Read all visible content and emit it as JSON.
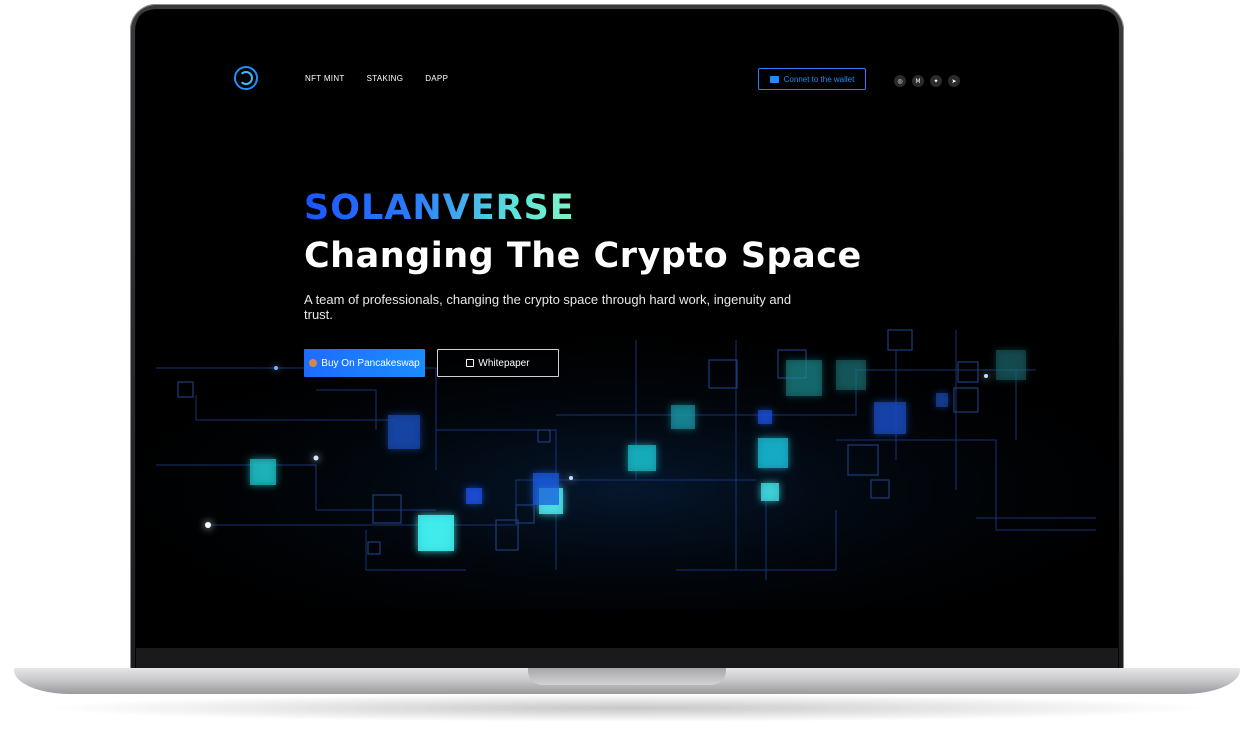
{
  "nav": {
    "items": [
      "NFT MINT",
      "STAKING",
      "DAPP"
    ]
  },
  "wallet": {
    "label": "Connet to the wallet"
  },
  "socials": [
    {
      "name": "instagram-icon",
      "glyph": "◎"
    },
    {
      "name": "medium-icon",
      "glyph": "M"
    },
    {
      "name": "twitter-icon",
      "glyph": "✦"
    },
    {
      "name": "telegram-icon",
      "glyph": "➤"
    }
  ],
  "hero": {
    "brand": "SOLANVERSE",
    "headline": "Changing The Crypto Space",
    "subtitle": "A team of professionals, changing the crypto space through hard work, ingenuity and trust."
  },
  "buttons": {
    "buy": "Buy On Pancakeswap",
    "whitepaper": "Whitepaper"
  },
  "colors": {
    "accent": "#1e6cff",
    "brand_gradient_start": "#1a55ff",
    "brand_gradient_end": "#7ff0c8",
    "background": "#000000"
  }
}
